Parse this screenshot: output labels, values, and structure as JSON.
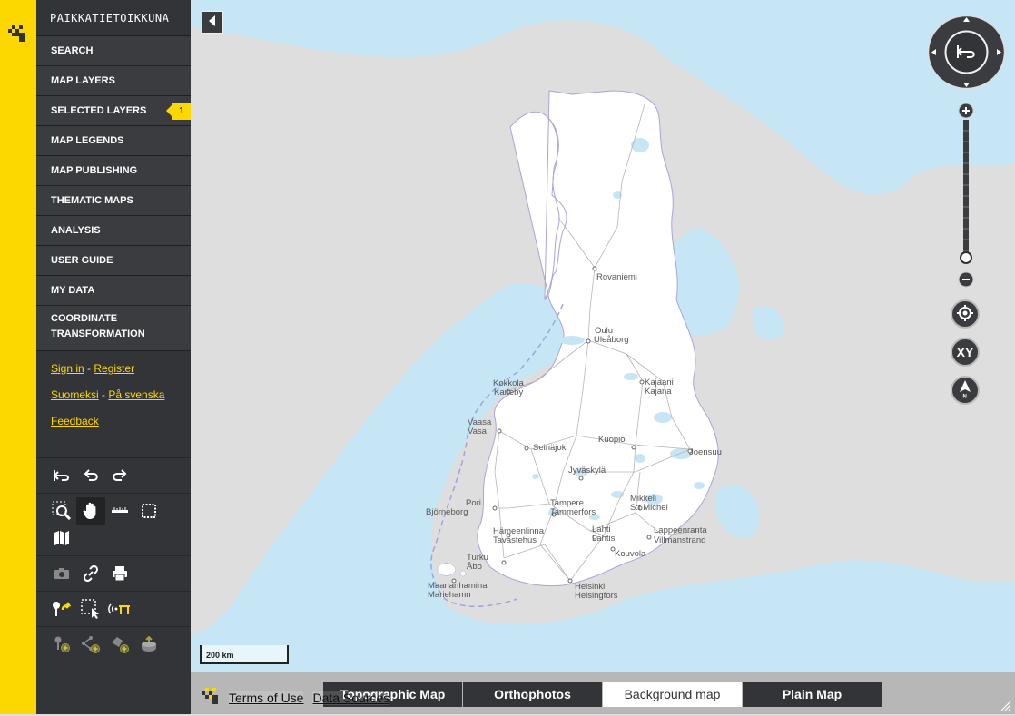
{
  "app": {
    "brand": "PAIKKATIETOIKKUNA"
  },
  "menu": [
    {
      "label": "SEARCH"
    },
    {
      "label": "MAP LAYERS"
    },
    {
      "label": "SELECTED LAYERS",
      "badge": "1"
    },
    {
      "label": "MAP LEGENDS"
    },
    {
      "label": "MAP PUBLISHING"
    },
    {
      "label": "THEMATIC MAPS"
    },
    {
      "label": "ANALYSIS"
    },
    {
      "label": "USER GUIDE"
    },
    {
      "label": "MY DATA"
    },
    {
      "label1": "COORDINATE",
      "label2": "TRANSFORMATION"
    }
  ],
  "account": {
    "sign_in": "Sign in",
    "sep": " - ",
    "register": "Register"
  },
  "languages": {
    "fi": "Suomeksi",
    "sep": " - ",
    "sv": "På svenska"
  },
  "feedback": "Feedback",
  "tool_icons": [
    [
      "reset-view-icon",
      "undo-icon",
      "redo-icon"
    ],
    [
      "zoom-box-icon",
      "pan-hand-icon",
      "measure-line-icon",
      "measure-area-icon",
      "map-book-icon"
    ],
    [
      "screenshot-camera-icon",
      "link-icon",
      "print-icon"
    ],
    [
      "marker-add-icon",
      "select-features-icon",
      "gps-signal-icon"
    ],
    [
      "add-point-icon",
      "add-line-icon",
      "add-area-icon",
      "add-layer-icon"
    ]
  ],
  "map": {
    "scale_label": "200 km",
    "colors": {
      "sea": "#c6e6f5",
      "land": "#dedede",
      "finland": "#ffffff",
      "lakes": "#c6e6f5",
      "roads": "#b0b0b0",
      "border": "#a8a4d8"
    },
    "places": [
      {
        "name": "Rovaniemi"
      },
      {
        "name": "Oulu"
      },
      {
        "name": "Uleåborg"
      },
      {
        "name": "Kokkola"
      },
      {
        "name": "Karleby"
      },
      {
        "name": "Kajaani"
      },
      {
        "name": "Kajana"
      },
      {
        "name": "Vaasa"
      },
      {
        "name": "Vasa"
      },
      {
        "name": "Seinäjoki"
      },
      {
        "name": "Kuopio"
      },
      {
        "name": "Joensuu"
      },
      {
        "name": "Jyväskylä"
      },
      {
        "name": "Pori"
      },
      {
        "name": "Björneborg"
      },
      {
        "name": "Tampere"
      },
      {
        "name": "Tammerfors"
      },
      {
        "name": "Mikkeli"
      },
      {
        "name": "S:t Michel"
      },
      {
        "name": "Hämeenlinna"
      },
      {
        "name": "Tavastehus"
      },
      {
        "name": "Lahti"
      },
      {
        "name": "Lahtis"
      },
      {
        "name": "Lappeenranta"
      },
      {
        "name": "Villmanstrand"
      },
      {
        "name": "Turku"
      },
      {
        "name": "Åbo"
      },
      {
        "name": "Kouvola"
      },
      {
        "name": "Maarianhamina"
      },
      {
        "name": "Mariehamn"
      },
      {
        "name": "Helsinki"
      },
      {
        "name": "Helsingfors"
      }
    ]
  },
  "controls": {
    "xy": "XY"
  },
  "basemaps": [
    {
      "label": "Topographic Map"
    },
    {
      "label": "Orthophotos"
    },
    {
      "label": "Background map",
      "selected": true
    },
    {
      "label": "Plain Map"
    }
  ],
  "footer": {
    "terms": "Terms of Use",
    "sources": "Data Sources"
  }
}
